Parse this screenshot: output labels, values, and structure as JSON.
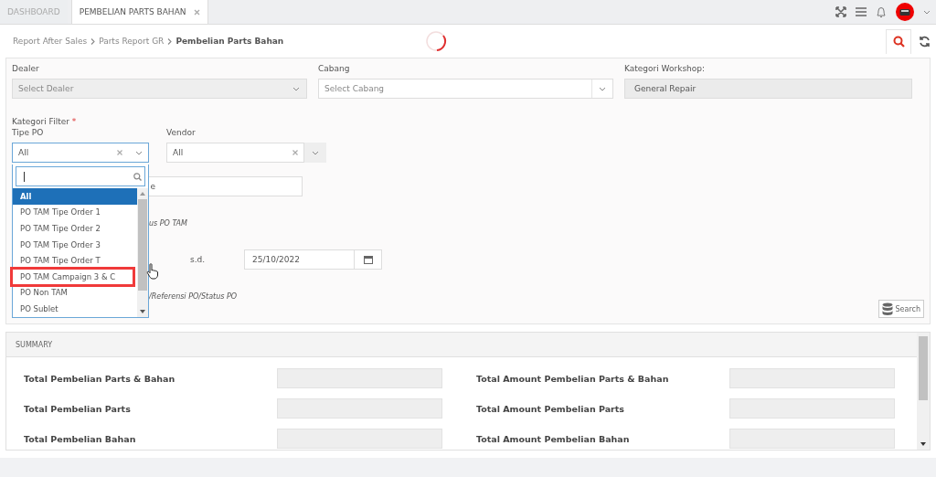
{
  "tabs": [
    {
      "label": "DASHBOARD",
      "selected": false,
      "closable": false
    },
    {
      "label": "PEMBELIAN PARTS BAHAN",
      "selected": true,
      "closable": true
    }
  ],
  "breadcrumb": [
    {
      "label": "Report After Sales",
      "current": false
    },
    {
      "label": "Parts Report GR",
      "current": false
    },
    {
      "label": "Pembelian Parts Bahan",
      "current": true
    }
  ],
  "filters": {
    "dealer": {
      "label": "Dealer",
      "placeholder": "Select Dealer",
      "disabled": true
    },
    "cabang": {
      "label": "Cabang",
      "placeholder": "Select Cabang",
      "disabled": false
    },
    "kategori_workshop": {
      "label": "Kategori Workshop:",
      "value": "General Repair"
    }
  },
  "kategori_filter": {
    "label": "Kategori Filter",
    "required_mark": "*"
  },
  "tipe_po": {
    "label": "Tipe PO",
    "value": "All",
    "open": true,
    "options": [
      {
        "label": "All",
        "selected": true
      },
      {
        "label": "PO TAM Tipe Order 1",
        "selected": false
      },
      {
        "label": "PO TAM Tipe Order 2",
        "selected": false
      },
      {
        "label": "PO TAM Tipe Order 3",
        "selected": false
      },
      {
        "label": "PO TAM Tipe Order T",
        "selected": false
      },
      {
        "label": "PO TAM Campaign 3 & C",
        "selected": false
      },
      {
        "label": "PO Non TAM",
        "selected": false
      },
      {
        "label": "PO Sublet",
        "selected": false
      }
    ]
  },
  "vendor": {
    "label": "Vendor",
    "value": "All"
  },
  "covered_rows": [
    {
      "kind": "field",
      "value": "e"
    },
    {
      "kind": "note",
      "text": "us PO TAM"
    },
    {
      "kind": "date",
      "label": "s.d.",
      "value": "25/10/2022"
    },
    {
      "kind": "note",
      "text": "/Referensi PO/Status PO"
    }
  ],
  "search_button": "Search",
  "summary": {
    "title": "SUMMARY",
    "items": [
      {
        "label": "Total Pembelian Parts & Bahan"
      },
      {
        "label": "Total Amount Pembelian Parts & Bahan"
      },
      {
        "label": "Total Pembelian Parts"
      },
      {
        "label": "Total Amount Pembelian Parts"
      },
      {
        "label": "Total Pembelian Bahan"
      },
      {
        "label": "Total Amount Pembelian Bahan"
      }
    ]
  }
}
